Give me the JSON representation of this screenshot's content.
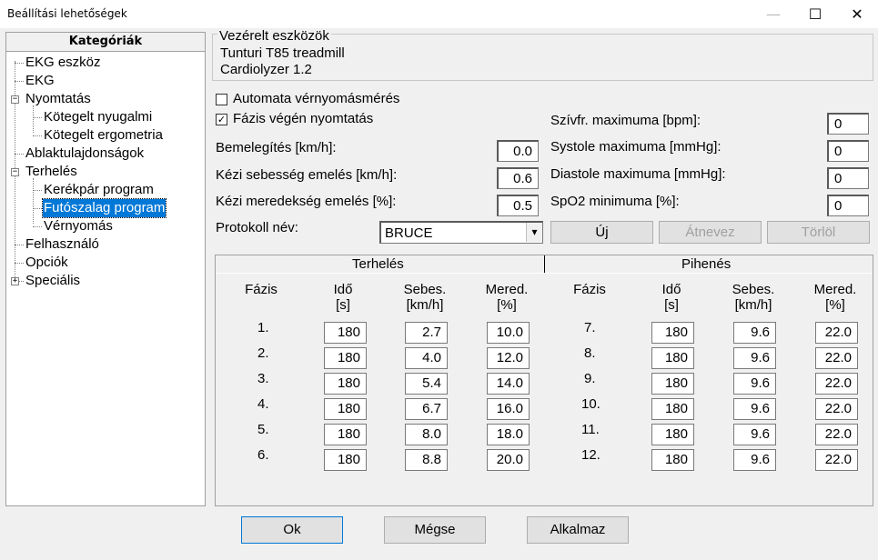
{
  "window": {
    "title": "Beállítási lehetőségek",
    "minimize_glyph": "—",
    "maximize_glyph": "☐",
    "close_glyph": "✕"
  },
  "tree": {
    "header": "Kategóriák",
    "items": [
      {
        "label": "EKG eszköz"
      },
      {
        "label": "EKG"
      },
      {
        "label": "Nyomtatás",
        "expander": "−"
      },
      {
        "label": "Kötegelt nyugalmi"
      },
      {
        "label": "Kötegelt ergometria"
      },
      {
        "label": "Ablaktulajdonságok"
      },
      {
        "label": "Terhelés",
        "expander": "−"
      },
      {
        "label": "Kerékpár program"
      },
      {
        "label": "Futószalag program",
        "selected": true
      },
      {
        "label": "Vérnyomás"
      },
      {
        "label": "Felhasználó"
      },
      {
        "label": "Opciók"
      },
      {
        "label": "Speciális",
        "expander": "+"
      }
    ]
  },
  "devices": {
    "legend": "Vezérelt eszközök",
    "line1": "Tunturi T85 treadmill",
    "line2": "Cardiolyzer 1.2"
  },
  "options": {
    "auto_bp": {
      "label": "Automata vérnyomásmérés",
      "checked": false,
      "mark": ""
    },
    "print_end": {
      "label": "Fázis végén nyomtatás",
      "checked": true,
      "mark": "✓"
    }
  },
  "left_fields": [
    {
      "label": "Bemelegítés [km/h]:",
      "value": "0.0"
    },
    {
      "label": "Kézi sebesség emelés [km/h]:",
      "value": "0.6"
    },
    {
      "label": "Kézi meredekség emelés [%]:",
      "value": "0.5"
    }
  ],
  "right_fields": [
    {
      "label": "Szívfr. maximuma [bpm]:",
      "value": "0"
    },
    {
      "label": "Systole maximuma [mmHg]:",
      "value": "0"
    },
    {
      "label": "Diastole maximuma [mmHg]:",
      "value": "0"
    },
    {
      "label": "SpO2 minimuma [%]:",
      "value": "0"
    }
  ],
  "protocol": {
    "label": "Protokoll név:",
    "value": "BRUCE",
    "dropdown_glyph": "▾",
    "new_label": "Új",
    "rename_label": "Átnevez",
    "delete_label": "Törlöl"
  },
  "tabs": {
    "load": "Terhelés",
    "rest": "Pihenés"
  },
  "columns": {
    "phase": "Fázis",
    "time": "Idő",
    "time_unit": "[s]",
    "speed": "Sebes.",
    "speed_unit": "[km/h]",
    "slope": "Mered.",
    "slope_unit": "[%]"
  },
  "load_rows": [
    {
      "phase": "1.",
      "time": "180",
      "speed": "2.7",
      "slope": "10.0"
    },
    {
      "phase": "2.",
      "time": "180",
      "speed": "4.0",
      "slope": "12.0"
    },
    {
      "phase": "3.",
      "time": "180",
      "speed": "5.4",
      "slope": "14.0"
    },
    {
      "phase": "4.",
      "time": "180",
      "speed": "6.7",
      "slope": "16.0"
    },
    {
      "phase": "5.",
      "time": "180",
      "speed": "8.0",
      "slope": "18.0"
    },
    {
      "phase": "6.",
      "time": "180",
      "speed": "8.8",
      "slope": "20.0"
    }
  ],
  "rest_rows": [
    {
      "phase": "7.",
      "time": "180",
      "speed": "9.6",
      "slope": "22.0"
    },
    {
      "phase": "8.",
      "time": "180",
      "speed": "9.6",
      "slope": "22.0"
    },
    {
      "phase": "9.",
      "time": "180",
      "speed": "9.6",
      "slope": "22.0"
    },
    {
      "phase": "10.",
      "time": "180",
      "speed": "9.6",
      "slope": "22.0"
    },
    {
      "phase": "11.",
      "time": "180",
      "speed": "9.6",
      "slope": "22.0"
    },
    {
      "phase": "12.",
      "time": "180",
      "speed": "9.6",
      "slope": "22.0"
    }
  ],
  "footer": {
    "ok": "Ok",
    "cancel": "Mégse",
    "apply": "Alkalmaz"
  }
}
